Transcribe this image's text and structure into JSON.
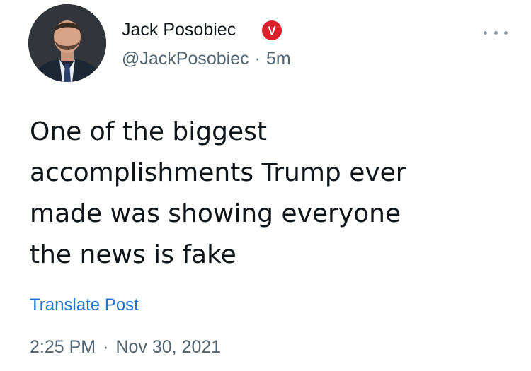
{
  "author": {
    "display_name": "Jack Posobiec",
    "handle": "@JackPosobiec",
    "relative_time": "5m",
    "separator": "·",
    "verified_badge_letter": "V",
    "badge_color": "#d9202b",
    "avatar_icon": "profile-photo"
  },
  "menu": {
    "icon": "more-horizontal-icon"
  },
  "post": {
    "text": "One of the biggest\naccomplishments Trump ever\nmade was showing everyone\nthe news is fake"
  },
  "translate": {
    "label": "Translate Post",
    "color": "#1d73d6"
  },
  "meta": {
    "time": "2:25 PM",
    "separator": "·",
    "date": "Nov 30, 2021"
  }
}
